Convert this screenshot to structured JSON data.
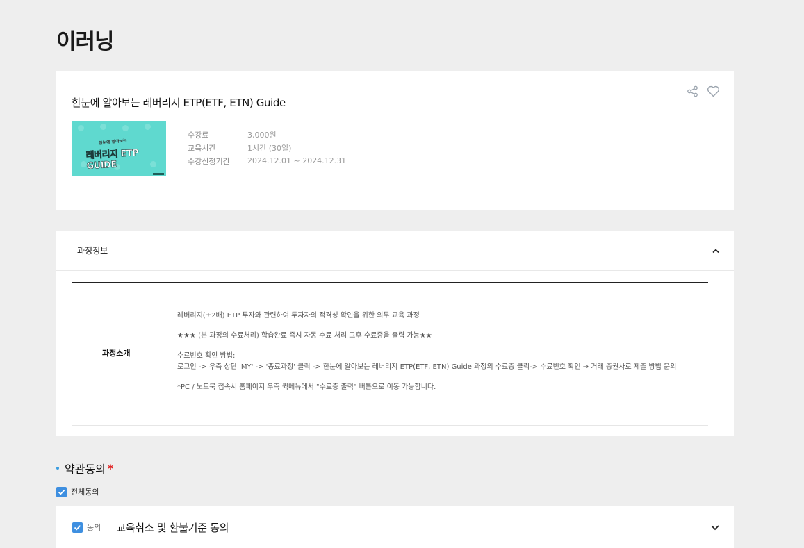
{
  "page": {
    "title": "이러닝"
  },
  "course": {
    "title": "한눈에 알아보는 레버리지 ETP(ETF, ETN) Guide",
    "thumbnail": {
      "subtitle": "한눈에 알아보는",
      "main_text": "레버리지 ETP GUIDE"
    },
    "info": [
      {
        "label": "수강료",
        "value": "3,000원"
      },
      {
        "label": "교육시간",
        "value": "1시간 (30일)"
      },
      {
        "label": "수강신청기간",
        "value": "2024.12.01 ~ 2024.12.31"
      }
    ],
    "actions": {
      "share_icon": "share-icon",
      "like_icon": "heart-icon"
    }
  },
  "detail": {
    "header": "과정정보",
    "label": "과정소개",
    "lines": {
      "l1": "레버리지(±2배) ETP 투자와 관련하여 투자자의 적격성 확인을 위한 의무 교육 과정",
      "l2": "★★★ (본 과정의 수료처리) 학습완료 즉시 자동 수료 처리 그후 수료증을 출력 가능★★",
      "l3": "수료번호 확인 방법:",
      "l4": "로그인 -> 우측 상단 'MY' -> '종료과정'  클릭 -> 한눈에 알아보는 레버리지 ETP(ETF, ETN) Guide 과정의 수료증 클릭-> 수료번호 확인 → 거래 증권사로 제출 방법 문의",
      "l5": "*PC / 노트북 접속시 홈페이지 우측 퀵메뉴에서 \"수료증 출력\" 버튼으로 이동 가능합니다."
    }
  },
  "agreement": {
    "title": "약관동의",
    "required_mark": "*",
    "agree_all_label": "전체동의",
    "items": [
      {
        "check_label": "동의",
        "title": "교육취소 및 환불기준 동의"
      }
    ]
  },
  "colors": {
    "accent": "#3e8fe0",
    "background": "#eeeeee",
    "thumbnail": "#5fd9cf",
    "required": "#e02020"
  }
}
